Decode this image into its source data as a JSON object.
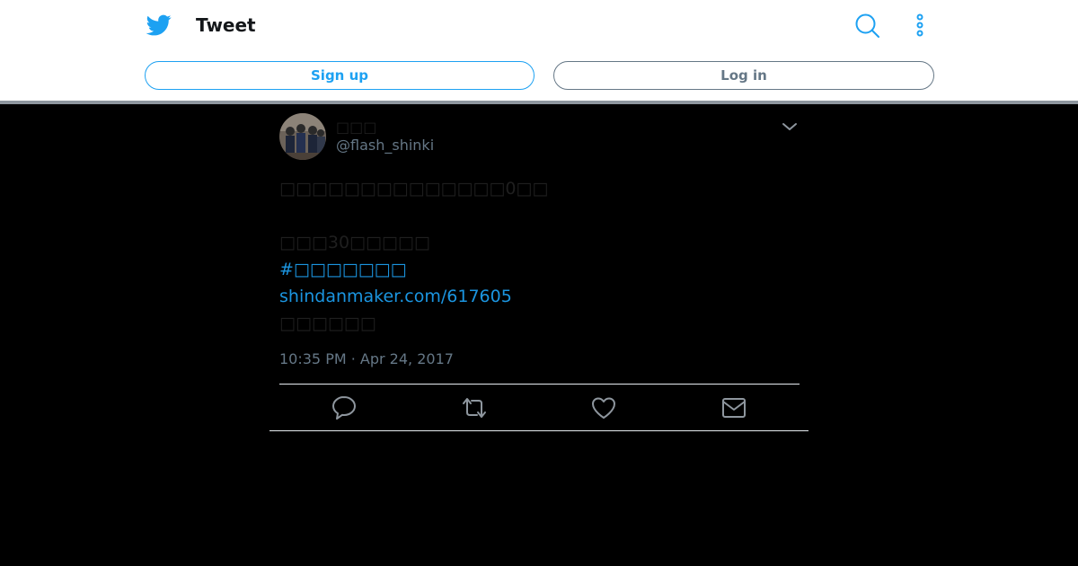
{
  "header": {
    "title": "Tweet",
    "signup_label": "Sign up",
    "login_label": "Log in",
    "icons": {
      "logo": "twitter-bird-icon",
      "search": "search-icon",
      "more": "more-vertical-icon"
    }
  },
  "tweet": {
    "display_name": "□□□",
    "handle": "@flash_shinki",
    "text_lines": [
      "□□□□□□□□□□□□□□0□□",
      "□□□30□□□□□",
      "#□□□□□□□",
      "shindanmaker.com/617605",
      "□□□□□□"
    ],
    "timestamp": "10:35 PM · Apr 24, 2017",
    "actions": [
      "reply-icon",
      "retweet-icon",
      "like-icon",
      "direct-message-icon"
    ]
  },
  "colors": {
    "brand": "#1da1f2",
    "link": "#1b95e0",
    "muted": "#657786",
    "background": "#000000"
  }
}
